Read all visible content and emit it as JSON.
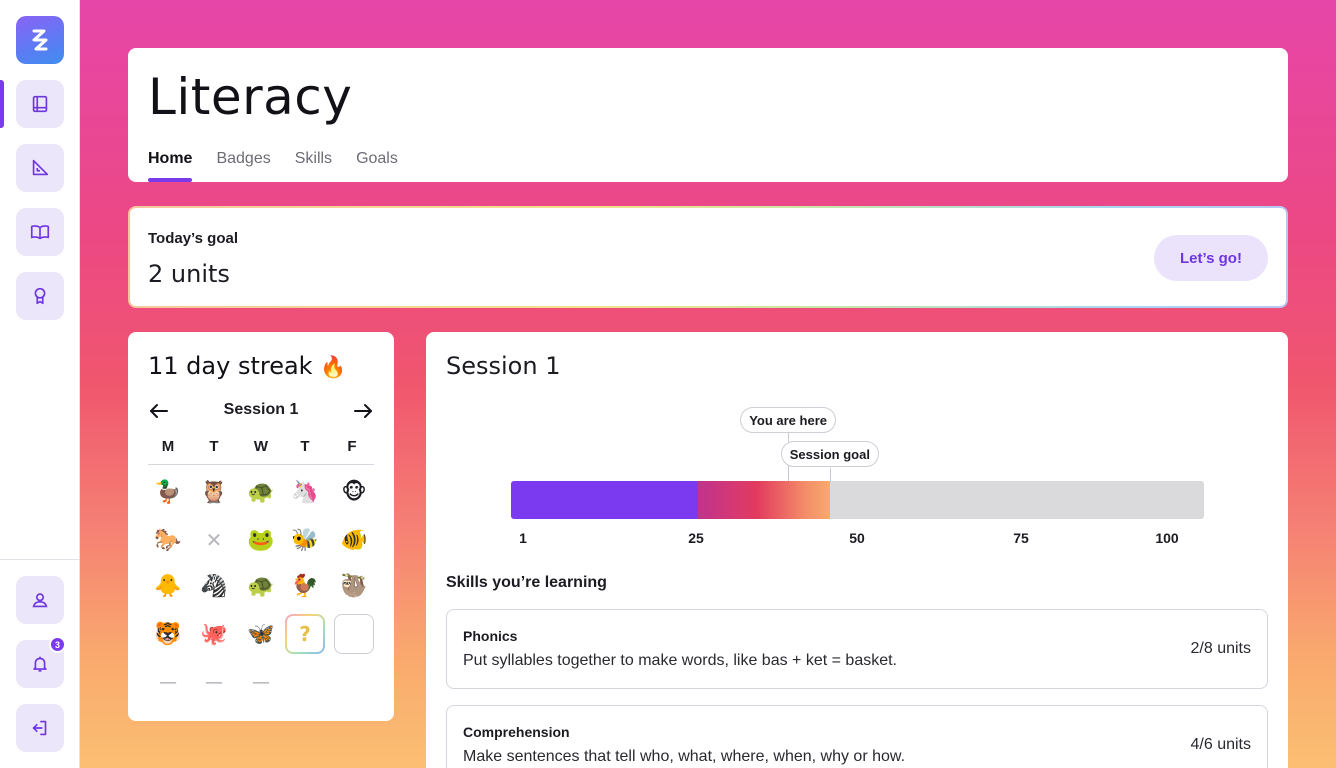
{
  "app": {
    "nav": [
      {
        "name": "literacy",
        "icon": "book-icon"
      },
      {
        "name": "math",
        "icon": "ruler-triangle-icon"
      },
      {
        "name": "reading",
        "icon": "open-book-icon"
      },
      {
        "name": "badges",
        "icon": "award-icon"
      }
    ],
    "bottom_nav": [
      {
        "name": "profile",
        "icon": "user-icon"
      },
      {
        "name": "notifications",
        "icon": "bell-icon",
        "badge": "3"
      },
      {
        "name": "logout",
        "icon": "logout-icon"
      }
    ],
    "accent": "#7c3aed"
  },
  "header": {
    "title": "Literacy",
    "tabs": [
      {
        "label": "Home",
        "active": true
      },
      {
        "label": "Badges",
        "active": false
      },
      {
        "label": "Skills",
        "active": false
      },
      {
        "label": "Goals",
        "active": false
      }
    ]
  },
  "goal": {
    "label": "Today’s goal",
    "value": "2 units",
    "button": "Let’s go!"
  },
  "streak": {
    "title": "11 day streak",
    "flame": "🔥",
    "session": "Session 1",
    "weekdays": [
      "M",
      "T",
      "W",
      "T",
      "F"
    ],
    "rows": [
      [
        "🦆",
        "🦉",
        "🐢",
        "🦄",
        "🐵"
      ],
      [
        "🐎",
        "✕",
        "🐸",
        "🐝",
        "🐠"
      ],
      [
        "🐥",
        "🦓",
        "🐢",
        "🐓",
        "🦥"
      ],
      [
        "🐯",
        "🐙",
        "🦋",
        "?",
        ""
      ],
      [
        "—",
        "—",
        "—",
        "",
        ""
      ]
    ]
  },
  "session": {
    "title": "Session 1",
    "you_are_here": "You are here",
    "session_goal": "Session goal",
    "progress": {
      "completed": 27,
      "you_are_here": 40,
      "goal": 46,
      "max": 100
    },
    "ticks": [
      "1",
      "25",
      "50",
      "75",
      "100"
    ],
    "skills_heading": "Skills you’re learning",
    "skills": [
      {
        "name": "Phonics",
        "description": "Put syllables together to make words, like bas + ket = basket.",
        "units": "2/8 units"
      },
      {
        "name": "Comprehension",
        "description": "Make sentences that tell who, what, where, when, why or how.",
        "units": "4/6 units"
      }
    ]
  }
}
